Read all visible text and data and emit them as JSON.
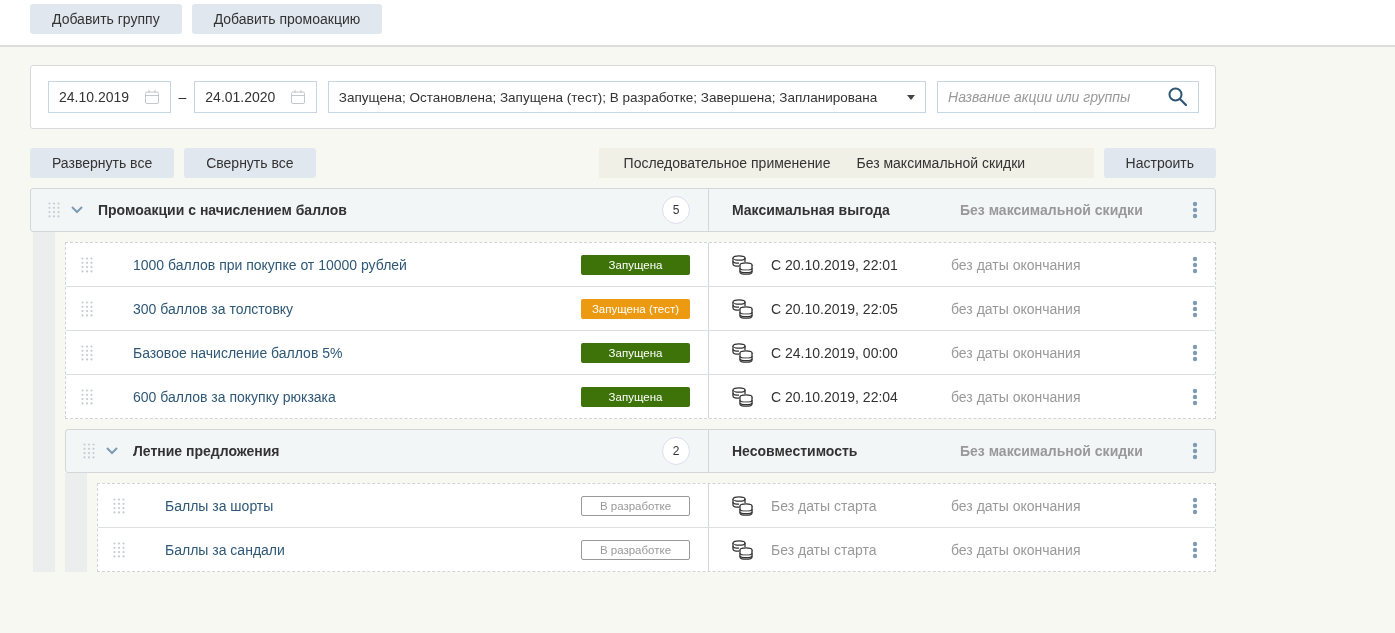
{
  "top_buttons": [
    "Добавить группу",
    "Добавить промоакцию"
  ],
  "filter": {
    "date_from": "24.10.2019",
    "dash": "–",
    "date_to": "24.01.2020",
    "statuses": "Запущена; Остановлена; Запущена (тест); В разработке; Завершена; Запланирована",
    "search_placeholder": "Название акции или группы"
  },
  "toolbar": {
    "expand": "Развернуть все",
    "collapse": "Свернуть все",
    "mode": "Последовательное применение",
    "max_discount": "Без максимальной скидки",
    "configure": "Настроить"
  },
  "groups": [
    {
      "title": "Промоакции с начислением баллов",
      "expanded": true,
      "count": "5",
      "mode": "Максимальная выгода",
      "max_discount": "Без максимальной скидки",
      "children": [
        {
          "kind": "promo",
          "name": "1000 баллов при покупке от 10000 рублей",
          "status": {
            "kind": "running",
            "label": "Запущена"
          },
          "start": "С 20.10.2019, 22:01",
          "end": "без даты окончания"
        },
        {
          "kind": "promo",
          "name": "300 баллов за толстовку",
          "status": {
            "kind": "test",
            "label": "Запущена (тест)"
          },
          "start": "С 20.10.2019, 22:05",
          "end": "без даты окончания"
        },
        {
          "kind": "promo",
          "name": "Базовое начисление баллов 5%",
          "status": {
            "kind": "running",
            "label": "Запущена"
          },
          "start": "С 24.10.2019, 00:00",
          "end": "без даты окончания"
        },
        {
          "kind": "promo",
          "name": "600 баллов за покупку рюкзака",
          "status": {
            "kind": "running",
            "label": "Запущена"
          },
          "start": "С 20.10.2019, 22:04",
          "end": "без даты окончания"
        },
        {
          "kind": "group",
          "title": "Летние предложения",
          "expanded": true,
          "count": "2",
          "mode": "Несовместимость",
          "max_discount": "Без максимальной скидки",
          "children": [
            {
              "kind": "promo",
              "name": "Баллы за шорты",
              "status": {
                "kind": "draft",
                "label": "В разработке"
              },
              "start": "Без даты старта",
              "end": "без даты окончания"
            },
            {
              "kind": "promo",
              "name": "Баллы за сандали",
              "status": {
                "kind": "draft",
                "label": "В разработке"
              },
              "start": "Без даты старта",
              "end": "без даты окончания"
            }
          ]
        }
      ]
    }
  ]
}
